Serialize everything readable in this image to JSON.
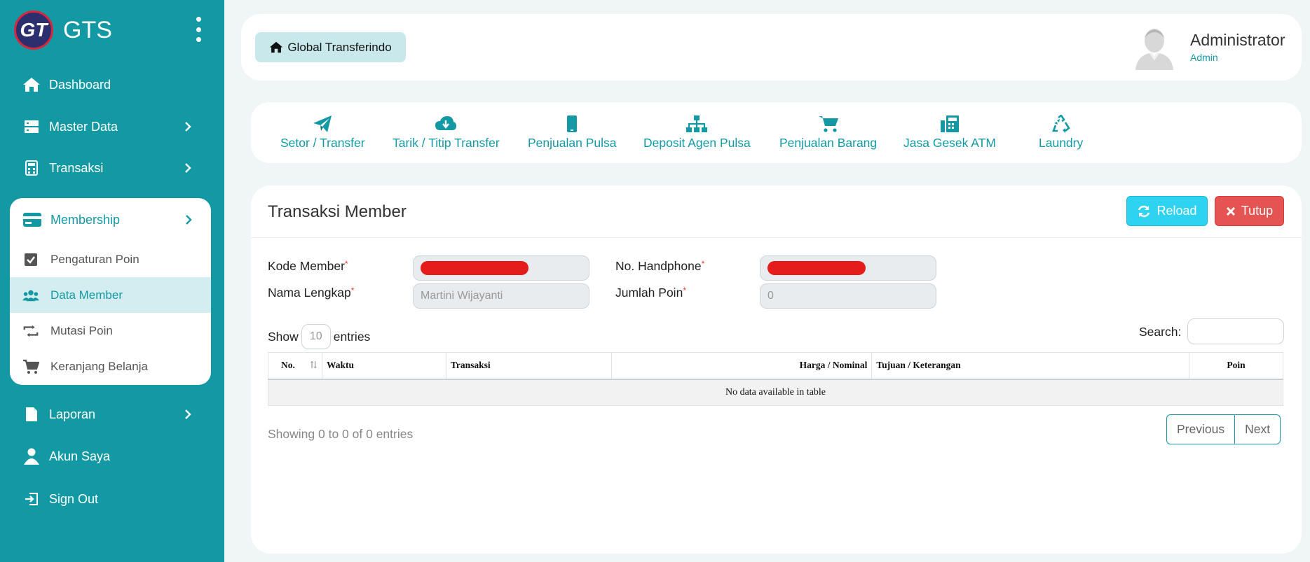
{
  "brand": {
    "logo_text": "GT",
    "name": "GTS"
  },
  "sidebar": {
    "items": [
      {
        "label": "Dashboard"
      },
      {
        "label": "Master Data"
      },
      {
        "label": "Transaksi"
      },
      {
        "label": "Membership"
      },
      {
        "label": "Laporan"
      },
      {
        "label": "Akun Saya"
      },
      {
        "label": "Sign Out"
      }
    ],
    "membership_sub": [
      {
        "label": "Pengaturan Poin"
      },
      {
        "label": "Data Member"
      },
      {
        "label": "Mutasi Poin"
      },
      {
        "label": "Keranjang Belanja"
      }
    ]
  },
  "header": {
    "home_label": "Global Transferindo",
    "user_name": "Administrator",
    "user_role": "Admin"
  },
  "quick_menu": [
    {
      "label": "Setor / Transfer"
    },
    {
      "label": "Tarik / Titip Transfer"
    },
    {
      "label": "Penjualan Pulsa"
    },
    {
      "label": "Deposit Agen Pulsa"
    },
    {
      "label": "Penjualan Barang"
    },
    {
      "label": "Jasa Gesek ATM"
    },
    {
      "label": "Laundry"
    }
  ],
  "main": {
    "title": "Transaksi Member",
    "reload_label": "Reload",
    "close_label": "Tutup",
    "form": {
      "kode_member_label": "Kode Member",
      "no_hp_label": "No. Handphone",
      "nama_label": "Nama Lengkap",
      "nama_value": "Martini Wijayanti",
      "poin_label": "Jumlah Poin",
      "poin_value": "0",
      "required_mark": "*"
    },
    "table": {
      "show_label": "Show",
      "page_length": "10",
      "entries_label": "entries",
      "search_label": "Search:",
      "columns": [
        "No.",
        "Waktu",
        "Transaksi",
        "Harga / Nominal",
        "Tujuan / Keterangan",
        "Poin"
      ],
      "empty_message": "No data available in table",
      "info": "Showing 0 to 0 of 0 entries",
      "prev_label": "Previous",
      "next_label": "Next"
    }
  },
  "colors": {
    "primary": "#1399a4",
    "reload": "#2ed3f1",
    "close": "#e55353",
    "redaction": "#e41c1c"
  }
}
